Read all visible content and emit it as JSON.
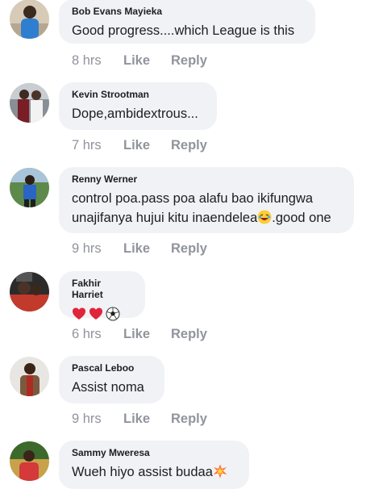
{
  "actions": {
    "like_label": "Like",
    "reply_label": "Reply"
  },
  "comments": [
    {
      "author": "Bob Evans Mayieka",
      "text": "Good progress....which League is this",
      "time": "8 hrs"
    },
    {
      "author": "Kevin Strootman",
      "text": "Dope,ambidextrous...",
      "time": "7 hrs"
    },
    {
      "author": "Renny Werner",
      "text_line1": "control poa.pass poa alafu bao ikifungwa",
      "text_line2": "unajifanya hujui kitu inaendelea",
      "text_line2_after": ".good one",
      "time": "9 hrs"
    },
    {
      "author": "Fakhir Harriet",
      "time": "6 hrs"
    },
    {
      "author": "Pascal Leboo",
      "text": "Assist noma",
      "time": "9 hrs"
    },
    {
      "author": "Sammy Mweresa",
      "text": "Wueh hiyo assist budaa"
    }
  ],
  "colors": {
    "bubble_bg": "#f0f2f5",
    "text": "#1c1e21",
    "meta_text": "#90949c"
  },
  "icons": {
    "c4_emojis": [
      "red-heart-icon",
      "red-heart-icon",
      "soccer-ball-icon"
    ],
    "c3_emoji": "laughing-face-icon",
    "c6_emoji": "collision-icon"
  }
}
